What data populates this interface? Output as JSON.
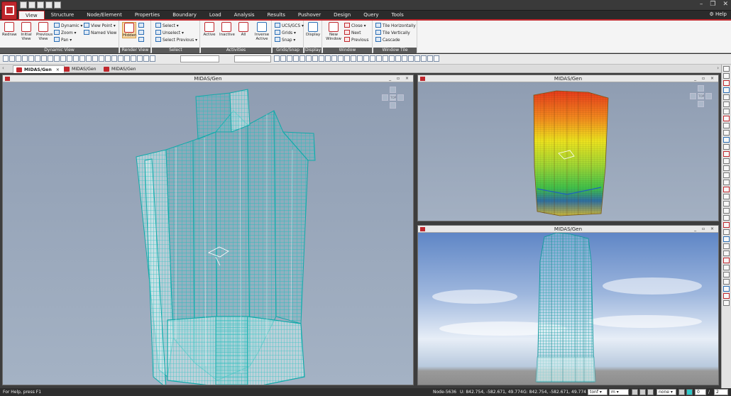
{
  "app": {
    "title": "MIDAS/Gen",
    "accent": "#c0272d",
    "help": "Help"
  },
  "ribbon_tabs": [
    {
      "label": "View",
      "active": true
    },
    {
      "label": "Structure"
    },
    {
      "label": "Node/Element"
    },
    {
      "label": "Properties"
    },
    {
      "label": "Boundary"
    },
    {
      "label": "Load"
    },
    {
      "label": "Analysis"
    },
    {
      "label": "Results"
    },
    {
      "label": "Pushover"
    },
    {
      "label": "Design"
    },
    {
      "label": "Query"
    },
    {
      "label": "Tools"
    }
  ],
  "ribbon": {
    "dynamic_view": {
      "title": "Dynamic View",
      "redraw": "Redraw",
      "initial": "Initial View",
      "previous": "Previous View",
      "dynamic": "Dynamic",
      "zoom": "Zoom",
      "pan": "Pan",
      "view_point": "View Point",
      "named_view": "Named View"
    },
    "render_view": {
      "title": "Render View",
      "hidden": "Hidden"
    },
    "select": {
      "title": "Select",
      "select": "Select",
      "unselect": "Unselect",
      "select_previous": "Select Previous"
    },
    "activities": {
      "title": "Activities",
      "active": "Active",
      "inactive": "Inactive",
      "all": "All",
      "inverse": "Inverse Active"
    },
    "grids_snap": {
      "title": "Grids/Snap",
      "ucs": "UCS/GCS",
      "grids": "Grids",
      "snap": "Snap"
    },
    "display": {
      "title": "Display",
      "display": "Display"
    },
    "window": {
      "title": "Window",
      "new_window": "New Window",
      "close": "Close",
      "next": "Next",
      "previous": "Previous"
    },
    "window_tile": {
      "title": "Window Tile",
      "horizontal": "Tile Horizontally",
      "vertical": "Tile Vertically",
      "cascade": "Cascade"
    }
  },
  "doc_tabs": [
    {
      "label": "MIDAS/Gen",
      "active": true,
      "close": "×"
    },
    {
      "label": "MIDAS/Gen"
    },
    {
      "label": "MIDAS/Gen"
    }
  ],
  "windows": [
    {
      "title": "MIDAS/Gen",
      "controls": "_ ▫ ×"
    },
    {
      "title": "MIDAS/Gen",
      "controls": "_ ▫ ×"
    },
    {
      "title": "MIDAS/Gen",
      "controls": "_ ▫ ×"
    }
  ],
  "viewcube_label": "TOP",
  "status": {
    "help": "For Help, press F1",
    "node": "Node-5636",
    "ucs_coord": "U: 842.754, -582.671, 49.774",
    "gcs_coord": "G: 842.754, -582.671, 49.774",
    "force_unit": "tonf",
    "length_unit": "m",
    "filter": "none",
    "page_current": "0",
    "page_sep": "/",
    "page_total": "2"
  }
}
